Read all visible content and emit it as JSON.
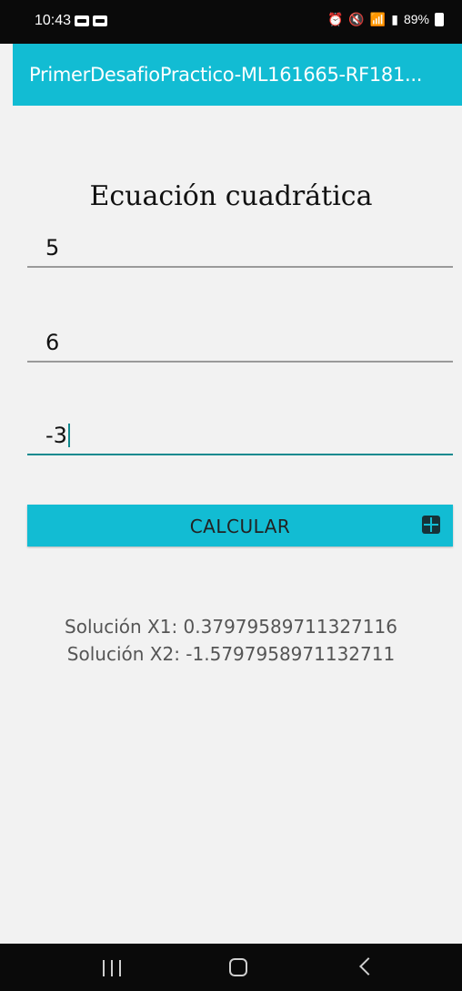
{
  "status_bar": {
    "time": "10:43",
    "battery_percent": "89%",
    "notification_icons": [
      "notification-icon",
      "notification-icon"
    ],
    "system_icons": [
      "alarm-icon",
      "mute-icon",
      "wifi-icon",
      "signal-icon",
      "signal-icon",
      "battery-icon"
    ]
  },
  "app_bar": {
    "title": "PrimerDesafioPractico-ML161665-RF181...",
    "color": "#12bcd3"
  },
  "main": {
    "heading": "Ecuación cuadrática",
    "inputs": [
      {
        "value": "5"
      },
      {
        "value": "6"
      },
      {
        "value": "-3"
      }
    ],
    "calculate_button": {
      "label": "CALCULAR",
      "icon": "calculator-icon"
    },
    "results": {
      "x1": "Solución X1: 0.37979589711327116",
      "x2": "Solución X2: -1.5797958971132711"
    }
  },
  "nav_bar": {
    "buttons": [
      "recents-icon",
      "home-icon",
      "back-icon"
    ]
  },
  "colors": {
    "accent": "#12bcd3",
    "focused_underline": "#138a8f",
    "background": "#f2f2f2"
  }
}
